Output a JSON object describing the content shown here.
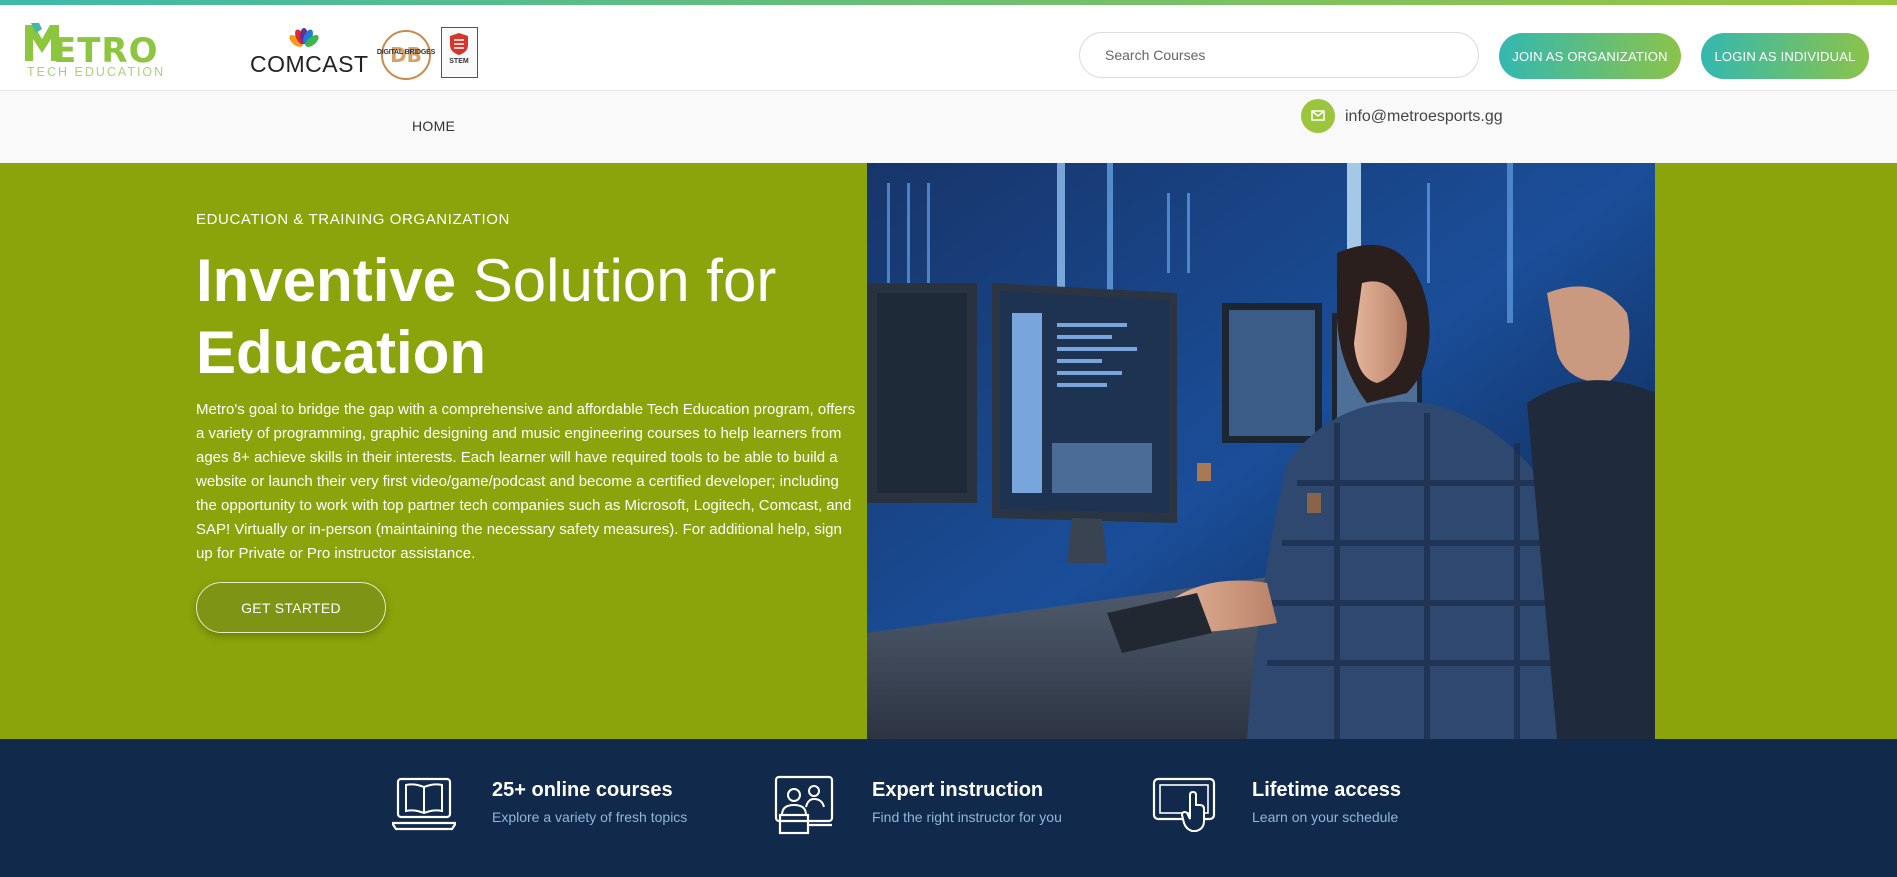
{
  "brand": {
    "logo_word": "ETRO",
    "logo_tagline": "TECH EDUCATION"
  },
  "partners": {
    "comcast": "COMCAST",
    "digital_bridges": "DIGITAL BRIDGES",
    "stem": "STEM"
  },
  "header": {
    "search_placeholder": "Search Courses",
    "join_org_label": "JOIN AS ORGANIZATION",
    "login_ind_label": "LOGIN AS INDIVIDUAL"
  },
  "nav": {
    "home_label": "HOME",
    "email": "info@metroesports.gg"
  },
  "hero": {
    "eyebrow": "EDUCATION & TRAINING ORGANIZATION",
    "headline_bold_1": "Inventive",
    "headline_regular": " Solution for",
    "headline_bold_2": "Education",
    "description": "Metro's goal to bridge the gap with a comprehensive and affordable Tech Education program, offers a variety of programming, graphic designing and music engineering courses to help learners from ages 8+ achieve skills in their interests. Each learner will have required tools to be able to build a website or launch their very first video/game/podcast and become a certified developer; including the opportunity to work with top partner tech companies such as Microsoft, Logitech, Comcast, and SAP! Virtually or in-person (maintaining the necessary safety measures). For additional help, sign up for Private or Pro instructor assistance.",
    "cta_label": "GET STARTED"
  },
  "features": [
    {
      "icon": "laptop-book-icon",
      "title": "25+ online courses",
      "subtitle": "Explore a variety of fresh topics"
    },
    {
      "icon": "instructor-icon",
      "title": "Expert instruction",
      "subtitle": "Find the right instructor for you"
    },
    {
      "icon": "tablet-touch-icon",
      "title": "Lifetime access",
      "subtitle": "Learn on your schedule"
    }
  ],
  "colors": {
    "accent_gradient_start": "#33b8b0",
    "accent_gradient_end": "#8bc34a",
    "hero_green": "#8ba40b",
    "footer_navy": "#11294a",
    "feature_subtitle": "#8fb7d8"
  }
}
